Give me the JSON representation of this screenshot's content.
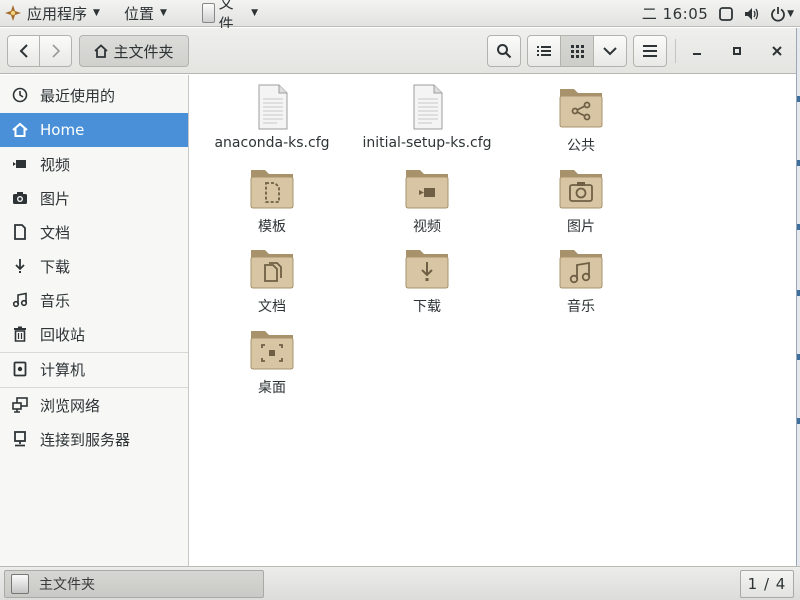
{
  "top_panel": {
    "applications_label": "应用程序",
    "places_label": "位置",
    "files_label": "文件",
    "clock": "二 16:05"
  },
  "headerbar": {
    "path_label": "主文件夹"
  },
  "sidebar": {
    "items": [
      {
        "label": "最近使用的",
        "icon": "clock-icon"
      },
      {
        "label": "Home",
        "icon": "home-icon",
        "active": true
      },
      {
        "label": "视频",
        "icon": "video-icon"
      },
      {
        "label": "图片",
        "icon": "camera-icon"
      },
      {
        "label": "文档",
        "icon": "document-icon"
      },
      {
        "label": "下载",
        "icon": "download-icon"
      },
      {
        "label": "音乐",
        "icon": "music-icon"
      },
      {
        "label": "回收站",
        "icon": "trash-icon"
      },
      {
        "label": "计算机",
        "icon": "computer-icon"
      },
      {
        "label": "浏览网络",
        "icon": "network-icon"
      },
      {
        "label": "连接到服务器",
        "icon": "server-icon"
      }
    ]
  },
  "files": [
    {
      "label": "anaconda-ks.cfg",
      "type": "text-file"
    },
    {
      "label": "initial-setup-ks.cfg",
      "type": "text-file"
    },
    {
      "label": "公共",
      "type": "folder-share"
    },
    {
      "label": "模板",
      "type": "folder-template"
    },
    {
      "label": "视频",
      "type": "folder-video"
    },
    {
      "label": "图片",
      "type": "folder-pictures"
    },
    {
      "label": "文档",
      "type": "folder-documents"
    },
    {
      "label": "下载",
      "type": "folder-download"
    },
    {
      "label": "音乐",
      "type": "folder-music"
    },
    {
      "label": "桌面",
      "type": "folder-desktop"
    }
  ],
  "bottom_panel": {
    "task_label": "主文件夹",
    "workspace": "1 / 4"
  },
  "colors": {
    "accent": "#4a90d9",
    "folder": "#cdb793"
  }
}
